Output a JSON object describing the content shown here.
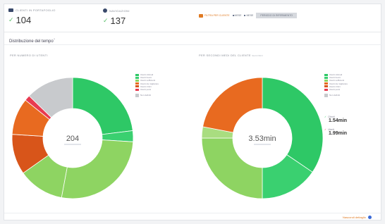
{
  "stats": [
    {
      "label": "Clienti in portafoglio",
      "value": "104"
    },
    {
      "label": "Navigazioni",
      "value": "137"
    }
  ],
  "filters": {
    "active": "Filtra per cliente",
    "f2": "Mese",
    "f3": "Mese",
    "f4": "Periodo di riferimento"
  },
  "section_title": "Distribuzione del tempo",
  "section_title_sup": "?",
  "colors": {
    "dark_green": "#2ec866",
    "mid_green": "#3ad070",
    "light_green": "#8ed462",
    "orange": "#e86a20",
    "dark_orange": "#d8551a",
    "red": "#e83a50",
    "gray": "#c8cacd",
    "accent": "#e07a22",
    "link": "#3a6ad6"
  },
  "charts": [
    {
      "label": "Per numero di utenti",
      "center": "204",
      "center_sub": "",
      "legend": [
        {
          "label": "Utenti ottimali",
          "color": "#2ec866"
        },
        {
          "label": "Utenti buoni",
          "color": "#3ad070"
        },
        {
          "label": "Utenti sufficienti",
          "color": "#8ed462"
        },
        {
          "label": "Utenti da migliorare",
          "color": "#e86a20"
        },
        {
          "label": "Utenti critici",
          "color": "#d8551a"
        },
        {
          "label": "Utenti persi",
          "color": "#e83a50"
        }
      ],
      "legend_extra": "Non definiti"
    },
    {
      "label": "Per secondi medi del cliente",
      "label_sub": "secondi",
      "center": "3.53min",
      "center_sub": "",
      "legend": [
        {
          "label": "Utenti ottimali",
          "color": "#2ec866"
        },
        {
          "label": "Utenti buoni",
          "color": "#3ad070"
        },
        {
          "label": "Utenti sufficienti",
          "color": "#8ed462"
        },
        {
          "label": "Utenti da migliorare",
          "color": "#e86a20"
        },
        {
          "label": "Utenti critici",
          "color": "#d8551a"
        },
        {
          "label": "Utenti persi",
          "color": "#e83a50"
        }
      ],
      "legend_extra": "Non definiti",
      "metrics": [
        {
          "label": "Clienti",
          "value": "1.54min",
          "color": "#2ec866"
        },
        {
          "label": "Utenti",
          "value": "1.99min",
          "color": "#e83a50"
        }
      ]
    }
  ],
  "chart_data": [
    {
      "type": "pie",
      "title": "Per numero di utenti",
      "slices": [
        {
          "value": 47,
          "color": "#2ec866"
        },
        {
          "value": 6,
          "color": "#3ad070"
        },
        {
          "value": 55,
          "color": "#8ed462"
        },
        {
          "value": 25,
          "color": "#8ed462"
        },
        {
          "value": 22,
          "color": "#d8551a"
        },
        {
          "value": 20,
          "color": "#e86a20"
        },
        {
          "value": 3,
          "color": "#e83a50"
        },
        {
          "value": 26,
          "color": "#c8cacd"
        }
      ]
    },
    {
      "type": "pie",
      "title": "Per secondi medi del cliente",
      "slices": [
        {
          "value": 34.5,
          "color": "#2ec866"
        },
        {
          "value": 15.5,
          "color": "#3ad070"
        },
        {
          "value": 25,
          "color": "#8ed462"
        },
        {
          "value": 3,
          "color": "#a9dd80"
        },
        {
          "value": 22,
          "color": "#e86a20"
        }
      ]
    }
  ],
  "footer_link": "Nascondi dettaglio"
}
